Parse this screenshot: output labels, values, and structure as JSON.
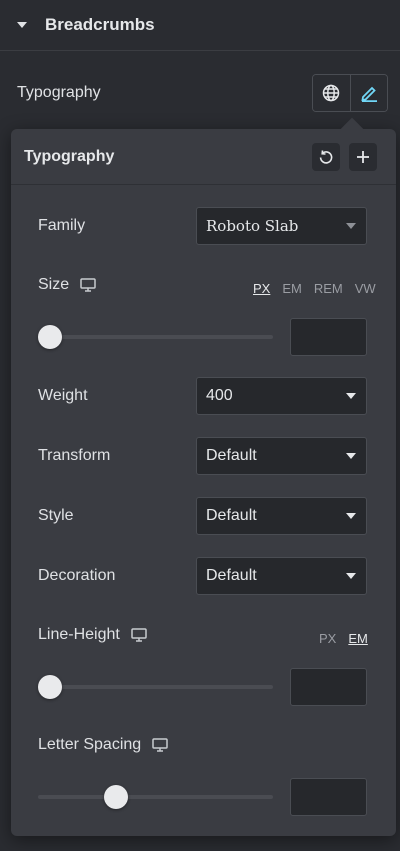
{
  "section": {
    "title": "Breadcrumbs"
  },
  "typography_row": {
    "label": "Typography"
  },
  "popover": {
    "title": "Typography",
    "family": {
      "label": "Family",
      "value": "Roboto Slab"
    },
    "size": {
      "label": "Size",
      "units": [
        "PX",
        "EM",
        "REM",
        "VW"
      ],
      "active_unit": "PX",
      "value": "",
      "slider_fraction": 0
    },
    "weight": {
      "label": "Weight",
      "value": "400"
    },
    "transform": {
      "label": "Transform",
      "value": "Default"
    },
    "style": {
      "label": "Style",
      "value": "Default"
    },
    "decoration": {
      "label": "Decoration",
      "value": "Default"
    },
    "line_height": {
      "label": "Line-Height",
      "units": [
        "PX",
        "EM"
      ],
      "active_unit": "EM",
      "value": "",
      "slider_fraction": 0
    },
    "letter_spacing": {
      "label": "Letter Spacing",
      "value": "",
      "slider_fraction": 0.33
    }
  },
  "colors": {
    "accent": "#71d7f7",
    "panel": "#3a3c42",
    "background": "#2a2c31"
  }
}
